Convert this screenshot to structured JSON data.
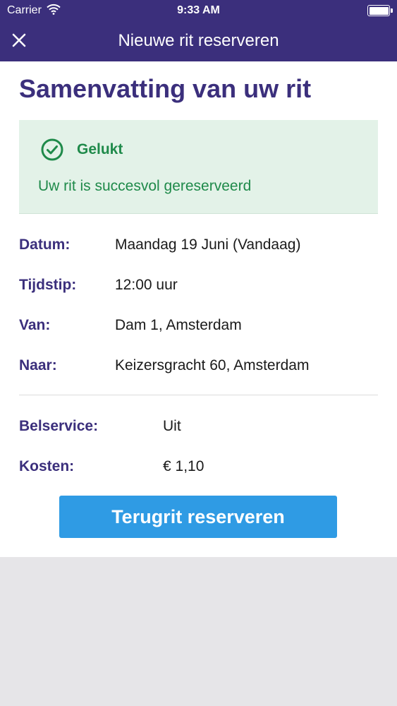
{
  "status_bar": {
    "carrier": "Carrier",
    "time": "9:33 AM"
  },
  "header": {
    "title": "Nieuwe rit reserveren",
    "close_icon": "close-icon"
  },
  "summary": {
    "title": "Samenvatting van uw rit",
    "success": {
      "title": "Gelukt",
      "message": "Uw rit is succesvol gereserveerd",
      "icon": "check-circle-icon"
    },
    "trip": [
      {
        "label": "Datum:",
        "value": "Maandag 19 Juni (Vandaag)"
      },
      {
        "label": "Tijdstip:",
        "value": "12:00 uur"
      },
      {
        "label": "Van:",
        "value": "Dam 1, Amsterdam"
      },
      {
        "label": "Naar:",
        "value": "Keizersgracht 60, Amsterdam"
      }
    ],
    "extras": [
      {
        "label": "Belservice:",
        "value": "Uit"
      },
      {
        "label": "Kosten:",
        "value": "€ 1,10"
      }
    ],
    "return_button": "Terugrit reserveren"
  },
  "colors": {
    "primary": "#3b2f7c",
    "success": "#1f8a4a",
    "success_bg": "#e3f2e8",
    "button": "#2f9be4"
  }
}
